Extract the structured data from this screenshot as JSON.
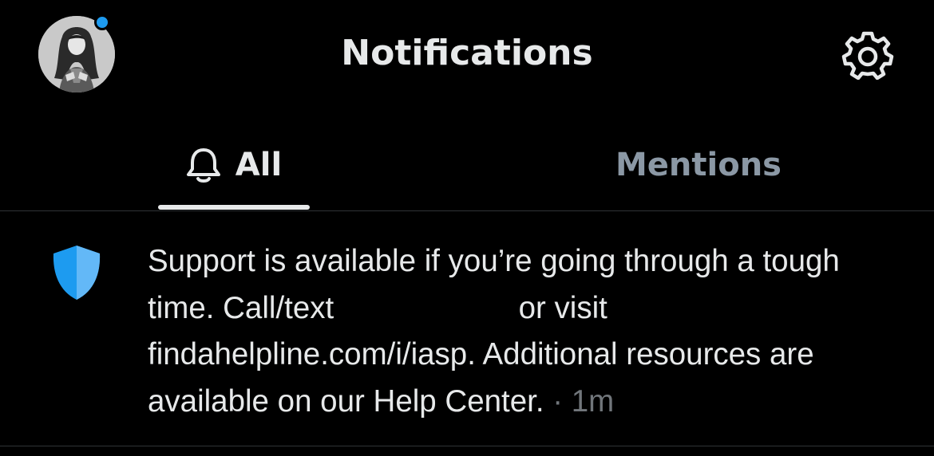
{
  "header": {
    "title": "Notifications",
    "avatar_icon": "user-avatar",
    "settings_icon": "gear-icon",
    "unread_dot_color": "#1d9bf0"
  },
  "tabs": [
    {
      "label": "All",
      "icon": "bell-icon",
      "active": true
    },
    {
      "label": "Mentions",
      "active": false
    }
  ],
  "notification": {
    "icon": "shield-icon",
    "icon_color": "#4ba8f5",
    "text_before_redaction": "Support is available if you’re going through a tough time. Call/text ",
    "text_after_redaction": " or visit findahelpline.com/i/iasp. Additional resources are available on our Help Center.",
    "separator": " · ",
    "time": "1m"
  },
  "colors": {
    "background": "#000000",
    "text_primary": "#e7e9ea",
    "text_secondary": "#71767b",
    "accent": "#1d9bf0",
    "divider": "#2f3336"
  }
}
